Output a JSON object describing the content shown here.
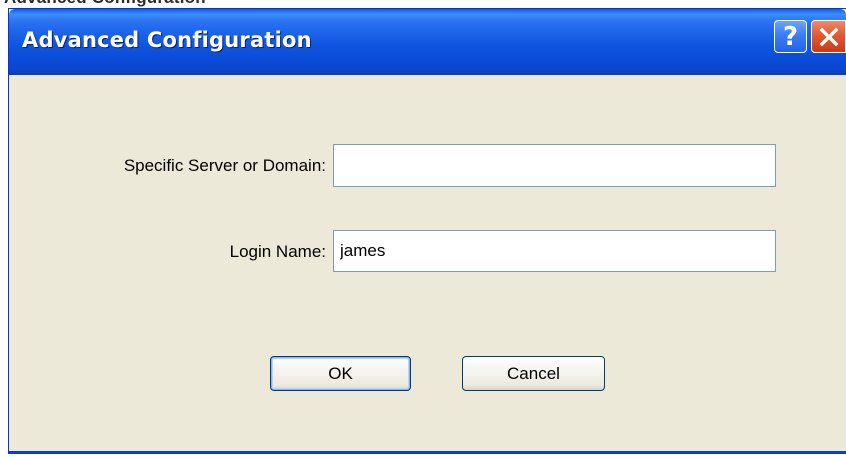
{
  "background_window": {
    "partial_title": "Advanced Configuration"
  },
  "dialog": {
    "title": "Advanced Configuration",
    "help_button_glyph": "?",
    "close_button_icon": "close-icon",
    "fields": {
      "server": {
        "label": "Specific Server or Domain:",
        "value": "",
        "placeholder": ""
      },
      "login": {
        "label": "Login Name:",
        "value": "james",
        "placeholder": ""
      }
    },
    "buttons": {
      "ok_label": "OK",
      "cancel_label": "Cancel"
    }
  },
  "colors": {
    "titlebar_blue": "#0a4ad6",
    "dialog_face": "#ece9d8",
    "close_red": "#e15a32",
    "field_border": "#7f9db9"
  }
}
